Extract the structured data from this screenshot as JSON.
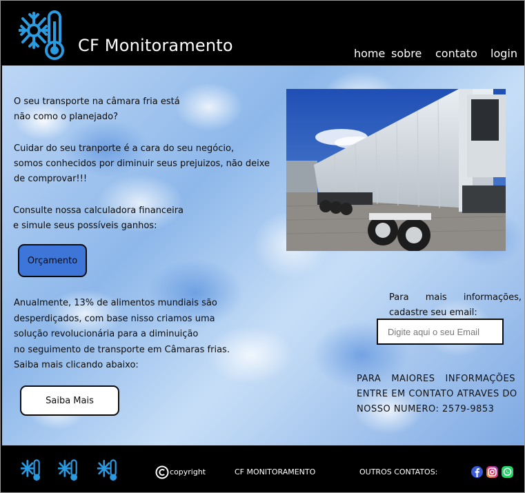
{
  "header": {
    "brand": "CF Monitoramento",
    "nav": {
      "home": "home",
      "sobre": "sobre",
      "contato": "contato",
      "login": "login"
    }
  },
  "main": {
    "intro": [
      "O seu transporte na câmara fria está",
      "não como o planejado?",
      "Cuidar do seu tranporte é a cara do seu negócio,",
      "somos conhecidos por diminuir seus prejuizos, não deixe",
      "de  comprovar!!!",
      "Consulte nossa calculadora financeira",
      "e simule seus possíveis ganhos:"
    ],
    "orcamento_button": "Orçamento",
    "waste": [
      "Anualmente, 13% de alimentos mundiais são",
      "desperdiçados, com base nisso criamos uma",
      "solução revolucionária para a diminuição",
      "no seguimento de transporte em Câmaras frias.",
      "Saiba mais clicando abaixo:"
    ],
    "saiba_button": "Saiba Mais",
    "email_prompt": [
      "Para mais informações,",
      "cadastre seu email:"
    ],
    "email_placeholder": "Digite aqui o seu Email",
    "contact_caps": [
      "PARA MAIORES INFORMAÇÕES",
      "ENTRE EM CONTATO ATRAVES DO",
      "NOSSO NUMERO: 2579-9853"
    ]
  },
  "footer": {
    "copyright": "copyright",
    "company": "CF MONITORAMENTO",
    "other_contacts": "OUTROS CONTATOS:"
  },
  "colors": {
    "header_bg": "#000000",
    "logo_blue": "#2a9be0",
    "button_blue": "#3d76d8"
  },
  "icons": [
    "snowflake-thermometer-icon",
    "copyright-icon",
    "facebook-icon",
    "instagram-icon",
    "whatsapp-icon"
  ]
}
